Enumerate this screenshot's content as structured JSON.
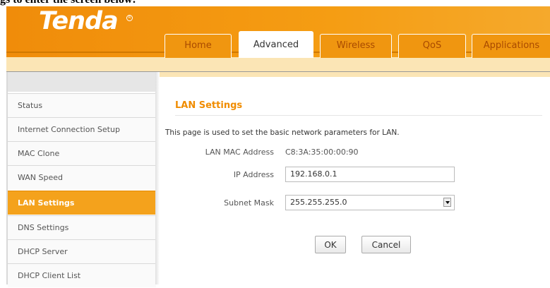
{
  "document": {
    "caption": "gs to enter the screen below:"
  },
  "header": {
    "logo_text": "Tenda",
    "tabs": [
      {
        "label": "Home",
        "active": false
      },
      {
        "label": "Advanced",
        "active": true
      },
      {
        "label": "Wireless",
        "active": false
      },
      {
        "label": "QoS",
        "active": false
      },
      {
        "label": "Applications",
        "active": false
      }
    ]
  },
  "sidebar": {
    "items": [
      {
        "label": "Status",
        "active": false
      },
      {
        "label": "Internet Connection Setup",
        "active": false
      },
      {
        "label": "MAC Clone",
        "active": false
      },
      {
        "label": "WAN Speed",
        "active": false
      },
      {
        "label": "LAN Settings",
        "active": true
      },
      {
        "label": "DNS Settings",
        "active": false
      },
      {
        "label": "DHCP Server",
        "active": false
      },
      {
        "label": "DHCP Client List",
        "active": false
      }
    ]
  },
  "main": {
    "title": "LAN Settings",
    "description": "This page is used to set the basic network parameters for LAN.",
    "mac_label": "LAN MAC Address",
    "mac_value": "C8:3A:35:00:00:90",
    "ip_label": "IP Address",
    "ip_value": "192.168.0.1",
    "mask_label": "Subnet Mask",
    "mask_value": "255.255.255.0",
    "ok_label": "OK",
    "cancel_label": "Cancel"
  },
  "colors": {
    "brand_orange": "#f08c0a",
    "active_nav": "#f4a21c",
    "title_orange": "#f08c00"
  }
}
